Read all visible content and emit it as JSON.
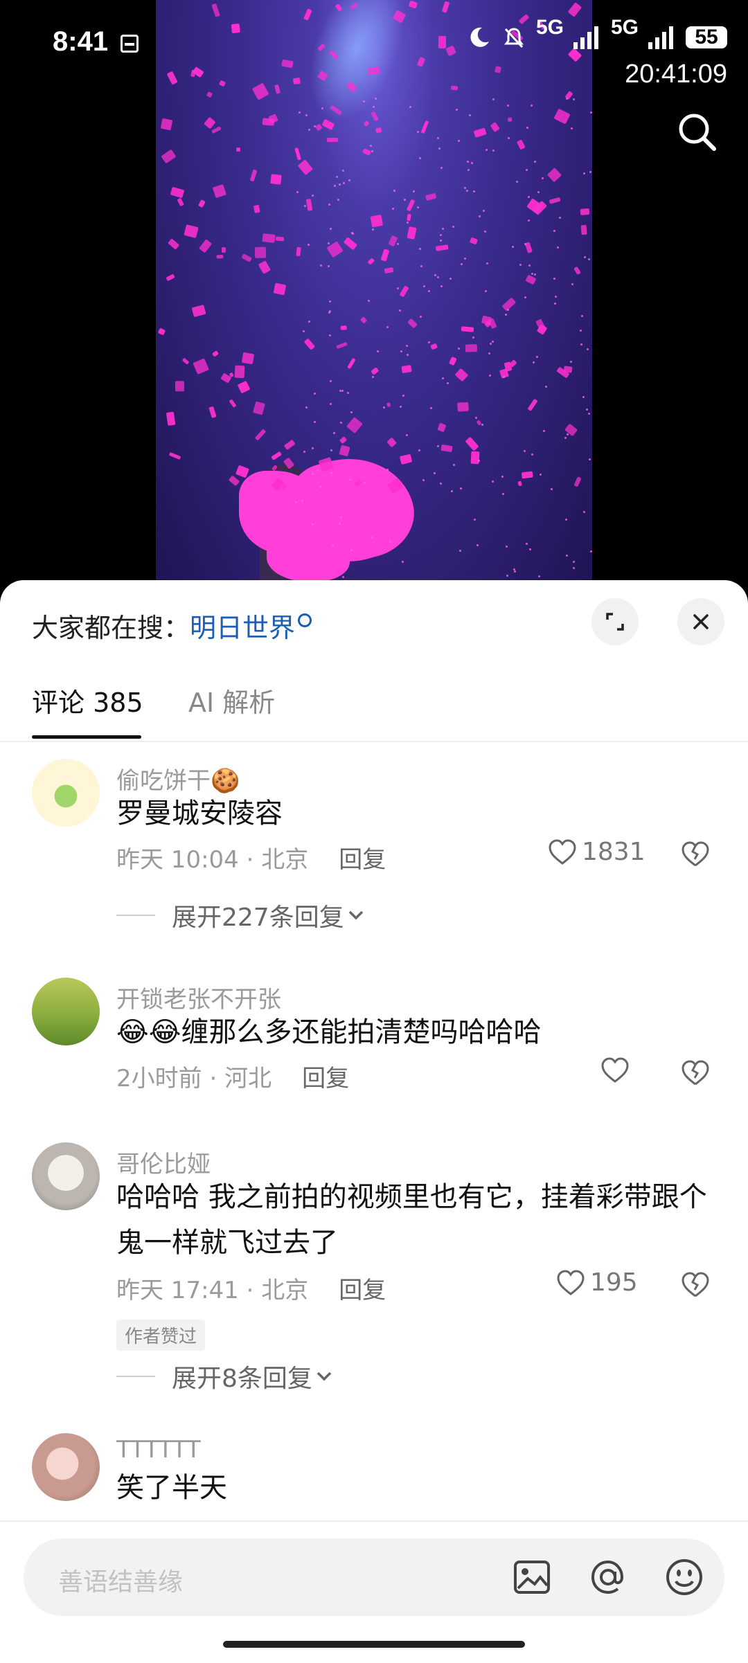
{
  "status_bar": {
    "time": "8:41",
    "network_1": "5G",
    "network_2": "5G",
    "battery": "55",
    "clock_overlay": "20:41:09"
  },
  "header": {
    "hot_search_label": "大家都在搜：",
    "hot_search_keyword": "明日世界"
  },
  "tabs": {
    "comments_label": "评论",
    "comments_count": "385",
    "ai_label": "AI 解析"
  },
  "comments": [
    {
      "username": "偷吃饼干🍪",
      "text": "罗曼城安陵容",
      "time": "昨天 10:04",
      "location": "北京",
      "reply_label": "回复",
      "likes": "1831",
      "expand_label": "展开227条回复"
    },
    {
      "username": "开锁老张不开张",
      "text": "😂😂缠那么多还能拍清楚吗哈哈哈",
      "time": "2小时前",
      "location": "河北",
      "reply_label": "回复",
      "likes": ""
    },
    {
      "username": "哥伦比娅",
      "text": "哈哈哈 我之前拍的视频里也有它，挂着彩带跟个鬼一样就飞过去了",
      "time": "昨天 17:41",
      "location": "北京",
      "reply_label": "回复",
      "likes": "195",
      "badge": "作者赞过",
      "expand_label": "展开8条回复"
    },
    {
      "username": "TTTTTT",
      "text": "笑了半天"
    }
  ],
  "input_bar": {
    "placeholder": "善语结善缘"
  },
  "colors": {
    "accent_link": "#1a5fb4",
    "video_petals": "#ff2fd0",
    "video_bg": "#3a2a8c"
  },
  "icons": [
    "search-icon",
    "expand-icon",
    "close-icon",
    "heart-icon",
    "broken-heart-icon",
    "chevron-down-icon",
    "image-icon",
    "at-icon",
    "emoji-icon"
  ]
}
